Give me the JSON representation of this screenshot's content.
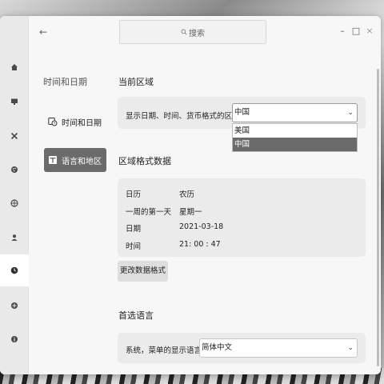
{
  "header": {
    "back_icon": "back-arrow-icon",
    "search_placeholder": "搜索",
    "window_controls": [
      "–",
      "□",
      "×"
    ]
  },
  "rail": {
    "icons": [
      "home-icon",
      "display-icon",
      "tools-icon",
      "personalization-icon",
      "network-icon",
      "account-icon",
      "clock-icon",
      "update-icon",
      "info-icon"
    ],
    "active": "clock-icon"
  },
  "nav": {
    "title": "时间和日期",
    "items": [
      {
        "label": "时间和日期",
        "icon": "calendar-clock-icon",
        "active": false
      },
      {
        "label": "语言和地区",
        "icon": "language-icon",
        "active": true
      }
    ]
  },
  "region": {
    "title": "当前区域",
    "row_label": "显示日期、时间、货币格式的区域",
    "selected": "中国",
    "options": [
      "美国",
      "中国"
    ]
  },
  "format": {
    "title": "区域格式数据",
    "rows": [
      {
        "label": "日历",
        "value": "农历"
      },
      {
        "label": "一周的第一天",
        "value": "星期一"
      },
      {
        "label": "日期",
        "value": "2021-03-18"
      },
      {
        "label": "时间",
        "value": "21: 00 : 47"
      }
    ],
    "button": "更改数据格式"
  },
  "language": {
    "title": "首选语言",
    "row_label": "系统，菜单的显示语言",
    "selected": "简体中文"
  }
}
